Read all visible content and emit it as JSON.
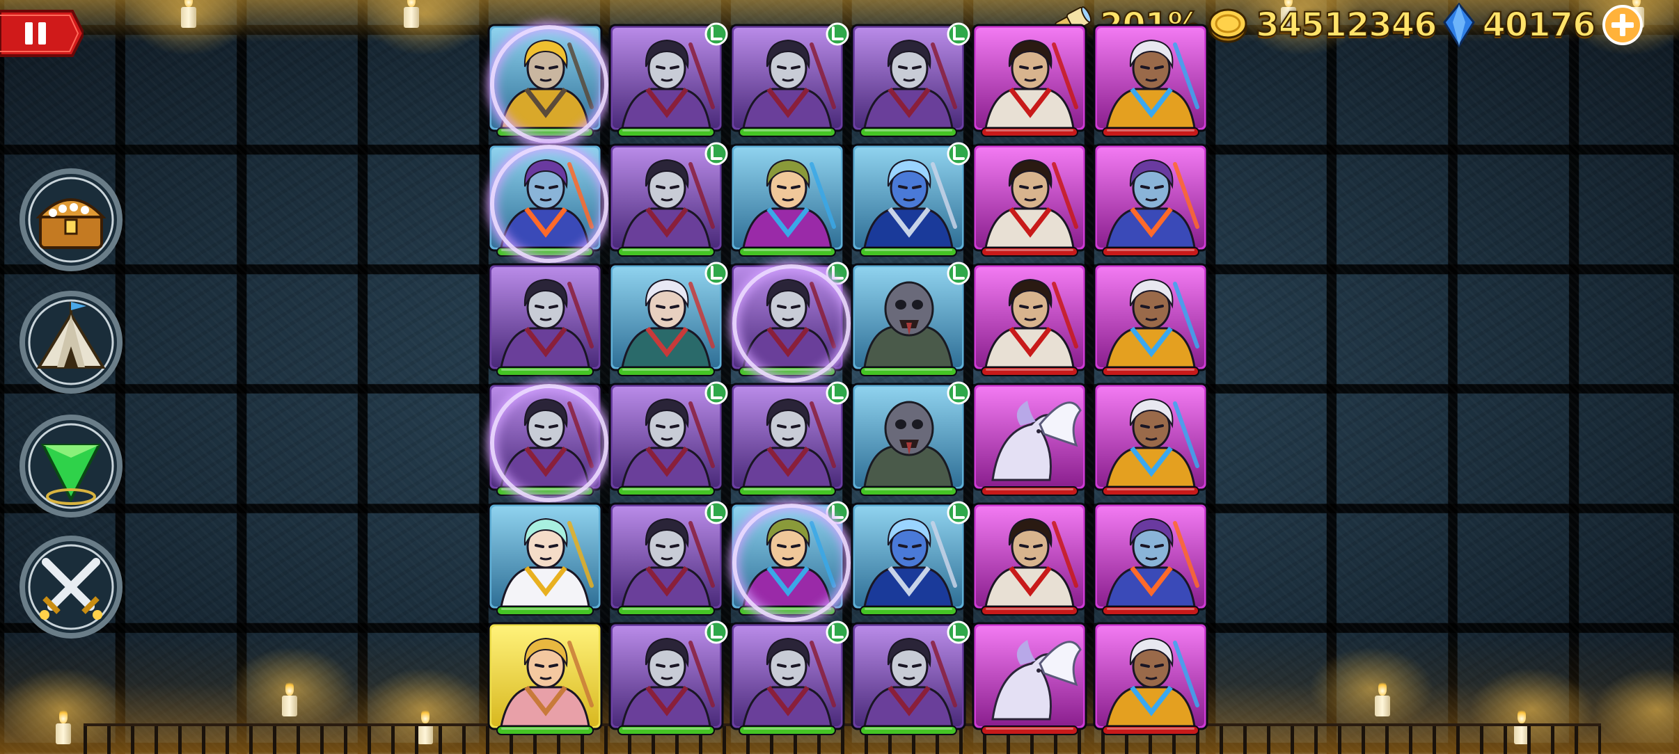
{
  "hud": {
    "boost_percent": "201%",
    "gold": "34512346",
    "gems": "40176",
    "icons": {
      "boost": "spyglass-icon",
      "gold": "gold-coin-icon",
      "gems": "blue-gem-icon",
      "add": "plus-icon"
    }
  },
  "side_menu": [
    {
      "id": "treasure",
      "icon": "treasure-chest-icon"
    },
    {
      "id": "camp",
      "icon": "tent-icon"
    },
    {
      "id": "summon",
      "icon": "green-crystal-icon"
    },
    {
      "id": "battle",
      "icon": "crossed-swords-icon"
    }
  ],
  "colors": {
    "hud_text": "#ffe36a",
    "pause_red": "#d01a1a",
    "frame_blue": "#5fb0d8",
    "frame_purple": "#6b3fa3",
    "frame_pink": "#d03ad6",
    "frame_yellow": "#f0e04a",
    "bar_green": "#45c425",
    "bar_red": "#c81a1a",
    "level_badge": "#2fa84a"
  },
  "board": {
    "rows": [
      [
        {
          "hero": "golden-armored-knight",
          "frame": "blue",
          "bar": "green",
          "badge": false,
          "selected": true
        },
        {
          "hero": "dark-archer",
          "frame": "purple",
          "bar": "green",
          "badge": true,
          "selected": false
        },
        {
          "hero": "dark-archer",
          "frame": "purple",
          "bar": "green",
          "badge": true,
          "selected": false
        },
        {
          "hero": "dark-archer",
          "frame": "purple",
          "bar": "green",
          "badge": true,
          "selected": false
        },
        {
          "hero": "samurai-warrior",
          "frame": "pink",
          "bar": "red",
          "badge": false,
          "selected": false
        },
        {
          "hero": "ice-mage",
          "frame": "pink",
          "bar": "red",
          "badge": false,
          "selected": false
        }
      ],
      [
        {
          "hero": "frost-sorceress",
          "frame": "blue",
          "bar": "green",
          "badge": false,
          "selected": true
        },
        {
          "hero": "dark-archer",
          "frame": "purple",
          "bar": "green",
          "badge": true,
          "selected": false
        },
        {
          "hero": "mermaid",
          "frame": "blue",
          "bar": "green",
          "badge": false,
          "selected": false
        },
        {
          "hero": "trident-sea-lord",
          "frame": "blue",
          "bar": "green",
          "badge": true,
          "selected": false
        },
        {
          "hero": "samurai-warrior",
          "frame": "pink",
          "bar": "red",
          "badge": false,
          "selected": false
        },
        {
          "hero": "frost-sorceress",
          "frame": "pink",
          "bar": "red",
          "badge": false,
          "selected": false
        }
      ],
      [
        {
          "hero": "dark-archer",
          "frame": "purple",
          "bar": "green",
          "badge": false,
          "selected": false
        },
        {
          "hero": "elf-ranger",
          "frame": "blue",
          "bar": "green",
          "badge": true,
          "selected": false
        },
        {
          "hero": "dark-archer",
          "frame": "purple",
          "bar": "green",
          "badge": true,
          "selected": true
        },
        {
          "hero": "zombie-brute",
          "frame": "blue",
          "bar": "green",
          "badge": true,
          "selected": false
        },
        {
          "hero": "samurai-warrior",
          "frame": "pink",
          "bar": "red",
          "badge": false,
          "selected": false
        },
        {
          "hero": "ice-mage",
          "frame": "pink",
          "bar": "red",
          "badge": false,
          "selected": false
        }
      ],
      [
        {
          "hero": "dark-archer",
          "frame": "purple",
          "bar": "green",
          "badge": false,
          "selected": true
        },
        {
          "hero": "dark-archer",
          "frame": "purple",
          "bar": "green",
          "badge": true,
          "selected": false
        },
        {
          "hero": "dark-archer",
          "frame": "purple",
          "bar": "green",
          "badge": true,
          "selected": false
        },
        {
          "hero": "zombie-brute",
          "frame": "blue",
          "bar": "green",
          "badge": true,
          "selected": false
        },
        {
          "hero": "pegasus",
          "frame": "pink",
          "bar": "red",
          "badge": false,
          "selected": false
        },
        {
          "hero": "ice-mage",
          "frame": "pink",
          "bar": "red",
          "badge": false,
          "selected": false
        }
      ],
      [
        {
          "hero": "holy-priestess",
          "frame": "blue",
          "bar": "green",
          "badge": false,
          "selected": false
        },
        {
          "hero": "dark-archer",
          "frame": "purple",
          "bar": "green",
          "badge": true,
          "selected": false
        },
        {
          "hero": "mermaid",
          "frame": "blue",
          "bar": "green",
          "badge": true,
          "selected": true
        },
        {
          "hero": "trident-sea-lord",
          "frame": "blue",
          "bar": "green",
          "badge": true,
          "selected": false
        },
        {
          "hero": "samurai-warrior",
          "frame": "pink",
          "bar": "red",
          "badge": false,
          "selected": false
        },
        {
          "hero": "frost-sorceress",
          "frame": "pink",
          "bar": "red",
          "badge": false,
          "selected": false
        }
      ],
      [
        {
          "hero": "forest-fairy",
          "frame": "yellow",
          "bar": "green",
          "badge": false,
          "selected": false
        },
        {
          "hero": "dark-archer",
          "frame": "purple",
          "bar": "green",
          "badge": true,
          "selected": false
        },
        {
          "hero": "dark-archer",
          "frame": "purple",
          "bar": "green",
          "badge": true,
          "selected": false
        },
        {
          "hero": "dark-archer",
          "frame": "purple",
          "bar": "green",
          "badge": true,
          "selected": false
        },
        {
          "hero": "pegasus",
          "frame": "pink",
          "bar": "red",
          "badge": false,
          "selected": false
        },
        {
          "hero": "ice-mage",
          "frame": "pink",
          "bar": "red",
          "badge": false,
          "selected": false
        }
      ]
    ]
  }
}
